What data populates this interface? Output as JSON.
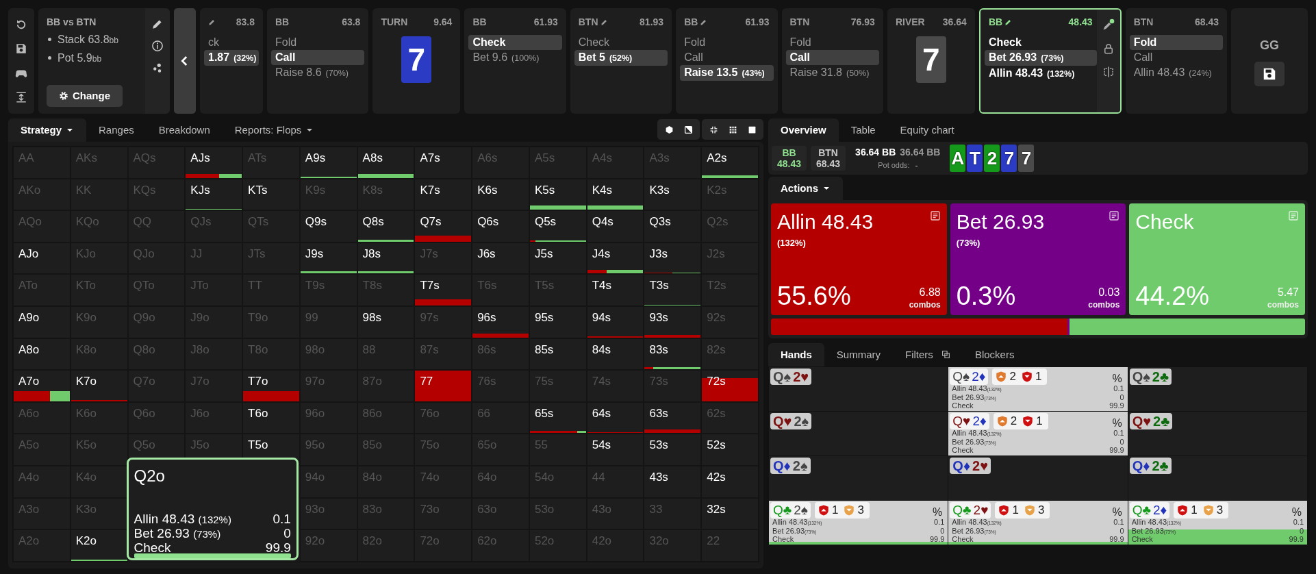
{
  "spot": {
    "title": "BB vs BTN",
    "stats": [
      {
        "label": "Stack 63.8",
        "unit": "bb"
      },
      {
        "label": "Pot 5.9",
        "unit": "bb"
      }
    ],
    "button": "Change"
  },
  "line": [
    {
      "kind": "decision",
      "edit": true,
      "active": false,
      "amount": "83.8",
      "options": [
        {
          "label": "ck",
          "selected": false
        },
        {
          "label": "1.87",
          "pct": "(32%)",
          "selected": true
        }
      ]
    },
    {
      "kind": "decision",
      "player": "BB",
      "edit": false,
      "active": false,
      "amount": "63.8",
      "options": [
        {
          "label": "Fold",
          "selected": false
        },
        {
          "label": "Call",
          "selected": true
        },
        {
          "label": "Raise 8.6",
          "pct": "(70%)",
          "selected": false
        }
      ]
    },
    {
      "kind": "street",
      "street": "TURN",
      "amount": "9.64",
      "card": {
        "rank": "7",
        "color": "#2b3bc4"
      }
    },
    {
      "kind": "decision",
      "player": "BB",
      "edit": false,
      "active": false,
      "amount": "61.93",
      "options": [
        {
          "label": "Check",
          "selected": true
        },
        {
          "label": "Bet 9.6",
          "pct": "(100%)",
          "selected": false
        }
      ]
    },
    {
      "kind": "decision",
      "player": "BTN",
      "edit": true,
      "active": false,
      "amount": "81.93",
      "options": [
        {
          "label": "Check",
          "selected": false
        },
        {
          "label": "Bet 5",
          "pct": "(52%)",
          "selected": true
        }
      ]
    },
    {
      "kind": "decision",
      "player": "BB",
      "edit": true,
      "active": false,
      "amount": "61.93",
      "options": [
        {
          "label": "Fold",
          "selected": false
        },
        {
          "label": "Call",
          "selected": false
        },
        {
          "label": "Raise 13.5",
          "pct": "(43%)",
          "selected": true
        }
      ]
    },
    {
      "kind": "decision",
      "player": "BTN",
      "edit": false,
      "active": false,
      "amount": "76.93",
      "options": [
        {
          "label": "Fold",
          "selected": false
        },
        {
          "label": "Call",
          "selected": true
        },
        {
          "label": "Raise 31.8",
          "pct": "(50%)",
          "selected": false
        }
      ]
    },
    {
      "kind": "street",
      "street": "RIVER",
      "amount": "36.64",
      "card": {
        "rank": "7",
        "color": "#4a4a4a"
      }
    },
    {
      "kind": "decision",
      "player": "BB",
      "edit": true,
      "active": true,
      "amount": "48.43",
      "options": [
        {
          "label": "Check",
          "selected": false
        },
        {
          "label": "Bet 26.93",
          "pct": "(73%)",
          "selected": true
        },
        {
          "label": "Allin 48.43",
          "pct": "(132%)",
          "selected": false
        }
      ]
    },
    {
      "kind": "decision",
      "player": "BTN",
      "edit": false,
      "active": false,
      "amount": "68.43",
      "options": [
        {
          "label": "Fold",
          "selected": true
        },
        {
          "label": "Call",
          "selected": false
        },
        {
          "label": "Allin 48.43",
          "pct": "(24%)",
          "selected": false
        }
      ]
    },
    {
      "kind": "end",
      "label": "GG"
    }
  ],
  "strategy_tabs": [
    {
      "label": "Strategy",
      "dropdown": true,
      "selected": true
    },
    {
      "label": "Ranges",
      "dropdown": false,
      "selected": false
    },
    {
      "label": "Breakdown",
      "dropdown": false,
      "selected": false
    },
    {
      "label": "Reports: Flops",
      "dropdown": true,
      "selected": false
    }
  ],
  "hand_grid": [
    [
      {
        "label": "AA",
        "in_range": false
      },
      {
        "label": "AKs",
        "in_range": false
      },
      {
        "label": "AQs",
        "in_range": false
      },
      {
        "label": "AJs",
        "in_range": true,
        "kind": "low",
        "mix": [
          {
            "kind": "allin",
            "level": 0.6
          },
          {
            "kind": "check",
            "level": 0.4
          }
        ]
      },
      {
        "label": "ATs",
        "in_range": false
      },
      {
        "label": "A9s",
        "in_range": true,
        "kind": "hairline",
        "mix": [
          {
            "kind": "check",
            "level": 1
          }
        ]
      },
      {
        "label": "A8s",
        "in_range": true,
        "kind": "low",
        "mix": [
          {
            "kind": "check",
            "level": 1
          }
        ]
      },
      {
        "label": "A7s",
        "in_range": true
      },
      {
        "label": "A6s",
        "in_range": false
      },
      {
        "label": "A5s",
        "in_range": false
      },
      {
        "label": "A4s",
        "in_range": false
      },
      {
        "label": "A3s",
        "in_range": false
      },
      {
        "label": "A2s",
        "in_range": true,
        "kind": "thin",
        "mix": [
          {
            "kind": "check",
            "level": 1
          }
        ]
      }
    ],
    [
      {
        "label": "AKo",
        "in_range": false
      },
      {
        "label": "KK",
        "in_range": false
      },
      {
        "label": "KQs",
        "in_range": false
      },
      {
        "label": "KJs",
        "in_range": true,
        "kind": "hairline",
        "mix": [
          {
            "kind": "check",
            "level": 1
          }
        ]
      },
      {
        "label": "KTs",
        "in_range": true
      },
      {
        "label": "K9s",
        "in_range": false
      },
      {
        "label": "K8s",
        "in_range": false
      },
      {
        "label": "K7s",
        "in_range": true
      },
      {
        "label": "K6s",
        "in_range": true
      },
      {
        "label": "K5s",
        "in_range": true,
        "kind": "low",
        "mix": [
          {
            "kind": "check",
            "level": 1
          }
        ]
      },
      {
        "label": "K4s",
        "in_range": true,
        "kind": "low",
        "mix": [
          {
            "kind": "check",
            "level": 1
          }
        ]
      },
      {
        "label": "K3s",
        "in_range": true
      },
      {
        "label": "K2s",
        "in_range": false
      }
    ],
    [
      {
        "label": "AQo",
        "in_range": false
      },
      {
        "label": "KQo",
        "in_range": false
      },
      {
        "label": "QQ",
        "in_range": false
      },
      {
        "label": "QJs",
        "in_range": false
      },
      {
        "label": "QTs",
        "in_range": false
      },
      {
        "label": "Q9s",
        "in_range": true
      },
      {
        "label": "Q8s",
        "in_range": true,
        "kind": "thin",
        "mix": [
          {
            "kind": "check",
            "level": 1
          }
        ]
      },
      {
        "label": "Q7s",
        "in_range": true,
        "kind": "mid",
        "mix": [
          {
            "kind": "allin",
            "level": 1
          }
        ]
      },
      {
        "label": "Q6s",
        "in_range": true
      },
      {
        "label": "Q5s",
        "in_range": true,
        "kind": "hairline",
        "mix": [
          {
            "kind": "allin",
            "level": 0.1
          },
          {
            "kind": "check",
            "level": 0.9
          }
        ]
      },
      {
        "label": "Q4s",
        "in_range": true
      },
      {
        "label": "Q3s",
        "in_range": true
      },
      {
        "label": "Q2s",
        "in_range": false
      }
    ],
    [
      {
        "label": "AJo",
        "in_range": true
      },
      {
        "label": "KJo",
        "in_range": false
      },
      {
        "label": "QJo",
        "in_range": false
      },
      {
        "label": "JJ",
        "in_range": false
      },
      {
        "label": "JTs",
        "in_range": false
      },
      {
        "label": "J9s",
        "in_range": true,
        "kind": "thin",
        "mix": [
          {
            "kind": "check",
            "level": 1
          }
        ]
      },
      {
        "label": "J8s",
        "in_range": true,
        "kind": "thin",
        "mix": [
          {
            "kind": "check",
            "level": 1
          }
        ]
      },
      {
        "label": "J7s",
        "in_range": false
      },
      {
        "label": "J6s",
        "in_range": true
      },
      {
        "label": "J5s",
        "in_range": true
      },
      {
        "label": "J4s",
        "in_range": true,
        "kind": "low",
        "mix": [
          {
            "kind": "allin",
            "level": 0.35
          },
          {
            "kind": "check",
            "level": 0.65
          }
        ]
      },
      {
        "label": "J3s",
        "in_range": true,
        "kind": "hairline",
        "mix": [
          {
            "kind": "allin",
            "level": 0.5
          },
          {
            "kind": "check",
            "level": 0.5
          }
        ]
      },
      {
        "label": "J2s",
        "in_range": false
      }
    ],
    [
      {
        "label": "ATo",
        "in_range": false
      },
      {
        "label": "KTo",
        "in_range": false
      },
      {
        "label": "QTo",
        "in_range": false
      },
      {
        "label": "JTo",
        "in_range": false
      },
      {
        "label": "TT",
        "in_range": false
      },
      {
        "label": "T9s",
        "in_range": false
      },
      {
        "label": "T8s",
        "in_range": false
      },
      {
        "label": "T7s",
        "in_range": true,
        "kind": "mid",
        "mix": [
          {
            "kind": "allin",
            "level": 1
          }
        ]
      },
      {
        "label": "T6s",
        "in_range": false
      },
      {
        "label": "T5s",
        "in_range": false
      },
      {
        "label": "T4s",
        "in_range": true
      },
      {
        "label": "T3s",
        "in_range": true,
        "kind": "hairline",
        "mix": [
          {
            "kind": "check",
            "level": 1
          }
        ]
      },
      {
        "label": "T2s",
        "in_range": false
      }
    ],
    [
      {
        "label": "A9o",
        "in_range": true
      },
      {
        "label": "K9o",
        "in_range": false
      },
      {
        "label": "Q9o",
        "in_range": false
      },
      {
        "label": "J9o",
        "in_range": false
      },
      {
        "label": "T9o",
        "in_range": false
      },
      {
        "label": "99",
        "in_range": false
      },
      {
        "label": "98s",
        "in_range": true
      },
      {
        "label": "97s",
        "in_range": false
      },
      {
        "label": "96s",
        "in_range": true,
        "kind": "low",
        "mix": [
          {
            "kind": "allin",
            "level": 1
          }
        ]
      },
      {
        "label": "95s",
        "in_range": true
      },
      {
        "label": "94s",
        "in_range": true,
        "kind": "hairline",
        "mix": [
          {
            "kind": "allin",
            "level": 1
          }
        ]
      },
      {
        "label": "93s",
        "in_range": true,
        "kind": "thin",
        "mix": [
          {
            "kind": "allin",
            "level": 1
          }
        ]
      },
      {
        "label": "92s",
        "in_range": false
      }
    ],
    [
      {
        "label": "A8o",
        "in_range": true
      },
      {
        "label": "K8o",
        "in_range": false
      },
      {
        "label": "Q8o",
        "in_range": false
      },
      {
        "label": "J8o",
        "in_range": false
      },
      {
        "label": "T8o",
        "in_range": false
      },
      {
        "label": "98o",
        "in_range": false
      },
      {
        "label": "88",
        "in_range": false
      },
      {
        "label": "87s",
        "in_range": false
      },
      {
        "label": "86s",
        "in_range": false
      },
      {
        "label": "85s",
        "in_range": true
      },
      {
        "label": "84s",
        "in_range": true
      },
      {
        "label": "83s",
        "in_range": true,
        "kind": "thin",
        "mix": [
          {
            "kind": "allin",
            "level": 0.15
          },
          {
            "kind": "check",
            "level": 0.85
          }
        ]
      },
      {
        "label": "82s",
        "in_range": false
      }
    ],
    [
      {
        "label": "A7o",
        "in_range": true,
        "kind": "half",
        "mix": [
          {
            "kind": "allin",
            "level": 0.65
          },
          {
            "kind": "check",
            "level": 0.35
          }
        ]
      },
      {
        "label": "K7o",
        "in_range": true,
        "kind": "hairline",
        "mix": [
          {
            "kind": "allin",
            "level": 1
          }
        ]
      },
      {
        "label": "Q7o",
        "in_range": false
      },
      {
        "label": "J7o",
        "in_range": false
      },
      {
        "label": "T7o",
        "in_range": true,
        "kind": "half",
        "mix": [
          {
            "kind": "allin",
            "level": 1
          }
        ]
      },
      {
        "label": "97o",
        "in_range": false
      },
      {
        "label": "87o",
        "in_range": false
      },
      {
        "label": "77",
        "in_range": true,
        "kind": "full",
        "mix": [
          {
            "kind": "allin",
            "level": 1
          }
        ]
      },
      {
        "label": "76s",
        "in_range": false
      },
      {
        "label": "75s",
        "in_range": false
      },
      {
        "label": "74s",
        "in_range": false
      },
      {
        "label": "73s",
        "in_range": false
      },
      {
        "label": "72s",
        "in_range": true,
        "kind": "high",
        "mix": [
          {
            "kind": "allin",
            "level": 1
          }
        ]
      }
    ],
    [
      {
        "label": "A6o",
        "in_range": false
      },
      {
        "label": "K6o",
        "in_range": false
      },
      {
        "label": "Q6o",
        "in_range": false
      },
      {
        "label": "J6o",
        "in_range": false
      },
      {
        "label": "T6o",
        "in_range": true
      },
      {
        "label": "96o",
        "in_range": false
      },
      {
        "label": "86o",
        "in_range": false
      },
      {
        "label": "76o",
        "in_range": false
      },
      {
        "label": "66",
        "in_range": false
      },
      {
        "label": "65s",
        "in_range": true,
        "kind": "thin",
        "mix": [
          {
            "kind": "allin",
            "level": 0.85
          },
          {
            "kind": "check",
            "level": 0.15
          }
        ]
      },
      {
        "label": "64s",
        "in_range": true,
        "kind": "hairline",
        "mix": [
          {
            "kind": "allin",
            "level": 1
          }
        ]
      },
      {
        "label": "63s",
        "in_range": true,
        "kind": "low",
        "mix": [
          {
            "kind": "allin",
            "level": 1
          }
        ]
      },
      {
        "label": "62s",
        "in_range": false
      }
    ],
    [
      {
        "label": "A5o",
        "in_range": false
      },
      {
        "label": "K5o",
        "in_range": false
      },
      {
        "label": "Q5o",
        "in_range": false
      },
      {
        "label": "J5o",
        "in_range": false
      },
      {
        "label": "T5o",
        "in_range": true
      },
      {
        "label": "95o",
        "in_range": false
      },
      {
        "label": "85o",
        "in_range": false
      },
      {
        "label": "75o",
        "in_range": false
      },
      {
        "label": "65o",
        "in_range": false
      },
      {
        "label": "55",
        "in_range": false
      },
      {
        "label": "54s",
        "in_range": true
      },
      {
        "label": "53s",
        "in_range": true
      },
      {
        "label": "52s",
        "in_range": true
      }
    ],
    [
      {
        "label": "A4o",
        "in_range": false
      },
      {
        "label": "K4o",
        "in_range": false
      },
      {
        "label": "94o",
        "in_range": false
      },
      {
        "label": "84o",
        "in_range": false
      },
      {
        "label": "74o",
        "in_range": false
      },
      {
        "label": "64o",
        "in_range": false
      },
      {
        "label": "54o",
        "in_range": false
      },
      {
        "label": "44",
        "in_range": false
      },
      {
        "label": "43s",
        "in_range": true
      },
      {
        "label": "42s",
        "in_range": true
      }
    ],
    [
      {
        "label": "A3o",
        "in_range": false
      },
      {
        "label": "K3o",
        "in_range": false
      },
      {
        "label": "93o",
        "in_range": false
      },
      {
        "label": "83o",
        "in_range": false
      },
      {
        "label": "73o",
        "in_range": false
      },
      {
        "label": "63o",
        "in_range": false
      },
      {
        "label": "53o",
        "in_range": false
      },
      {
        "label": "43o",
        "in_range": false
      },
      {
        "label": "33",
        "in_range": false
      },
      {
        "label": "32s",
        "in_range": true
      }
    ],
    [
      {
        "label": "A2o",
        "in_range": false
      },
      {
        "label": "K2o",
        "in_range": true,
        "kind": "hairline",
        "mix": [
          {
            "kind": "check",
            "level": 1
          }
        ]
      },
      {
        "label": "92o",
        "in_range": false
      },
      {
        "label": "82o",
        "in_range": false
      },
      {
        "label": "72o",
        "in_range": false
      },
      {
        "label": "62o",
        "in_range": false
      },
      {
        "label": "52o",
        "in_range": false
      },
      {
        "label": "42o",
        "in_range": false
      },
      {
        "label": "32o",
        "in_range": false
      },
      {
        "label": "22",
        "in_range": false
      }
    ]
  ],
  "tooltip": {
    "hand": "Q2o",
    "level": 0.999,
    "lines": [
      {
        "label": "Allin 48.43",
        "pct": "(132%)",
        "value": "0.1"
      },
      {
        "label": "Bet 26.93",
        "pct": "(73%)",
        "value": "0"
      },
      {
        "label": "Check",
        "value": "99.9"
      }
    ]
  },
  "overview_tabs": [
    {
      "label": "Overview",
      "selected": true
    },
    {
      "label": "Table",
      "selected": false
    },
    {
      "label": "Equity chart",
      "selected": false
    }
  ],
  "summary": {
    "players": [
      {
        "name": "BB",
        "stack": "48.43",
        "active": true
      },
      {
        "name": "BTN",
        "stack": "68.43",
        "active": false
      }
    ],
    "pot": "36.64 BB",
    "pot_alt": "36.64 BB",
    "pot_odds_label": "Pot odds:",
    "pot_odds": "-",
    "board": [
      {
        "rank": "A",
        "color": "#14991a"
      },
      {
        "rank": "T",
        "color": "#2b3bc4"
      },
      {
        "rank": "2",
        "color": "#14991a"
      },
      {
        "rank": "7",
        "color": "#2b3bc4"
      },
      {
        "rank": "7",
        "color": "#4a4a4a"
      }
    ]
  },
  "actions_tab": "Actions",
  "actions": [
    {
      "kind": "allin",
      "label": "Allin 48.43",
      "pct": "(132%)",
      "share": "55.6%",
      "combos": "6.88",
      "unit": "combos",
      "color": "#b50000",
      "level": 0.556
    },
    {
      "kind": "bet",
      "label": "Bet 26.93",
      "pct": "(73%)",
      "share": "0.3%",
      "combos": "0.03",
      "unit": "combos",
      "color": "#740087",
      "level": 0.003
    },
    {
      "kind": "check",
      "label": "Check",
      "share": "44.2%",
      "combos": "5.47",
      "unit": "combos",
      "color": "#6fcb6b",
      "level": 0.442
    }
  ],
  "hands_tabs": [
    {
      "label": "Hands",
      "selected": true
    },
    {
      "label": "Summary",
      "selected": false
    },
    {
      "label": "Filters",
      "selected": false
    },
    {
      "label": "Blockers",
      "selected": false
    }
  ],
  "combos": [
    {
      "kind": "plain",
      "in_range": false,
      "cards": [
        {
          "rank": "Q",
          "suit": "♠",
          "color": "#454545"
        },
        {
          "rank": "2",
          "suit": "♥",
          "color": "#7d1010"
        }
      ]
    },
    {
      "kind": "plain",
      "in_range": true,
      "cards": [
        {
          "rank": "Q",
          "suit": "♠",
          "color": "#454545"
        },
        {
          "rank": "2",
          "suit": "♦",
          "color": "#2233bb"
        }
      ],
      "blockers": [
        {
          "kind": "up",
          "color": "#e07a2e",
          "count": "2"
        },
        {
          "kind": "down",
          "color": "#d01010",
          "count": "1"
        }
      ],
      "unit": "%",
      "lines": [
        {
          "label": "Allin 48.43",
          "pct": "(132%)",
          "value": "0.1"
        },
        {
          "label": "Bet 26.93",
          "pct": "(73%)",
          "value": "0"
        },
        {
          "label": "Check",
          "value": "99.9"
        }
      ]
    },
    {
      "kind": "plain",
      "in_range": false,
      "cards": [
        {
          "rank": "Q",
          "suit": "♠",
          "color": "#454545"
        },
        {
          "rank": "2",
          "suit": "♣",
          "color": "#0e6a0e"
        }
      ]
    },
    {
      "kind": "plain",
      "in_range": false,
      "cards": [
        {
          "rank": "Q",
          "suit": "♥",
          "color": "#7d1010"
        },
        {
          "rank": "2",
          "suit": "♠",
          "color": "#454545"
        }
      ]
    },
    {
      "kind": "plain",
      "in_range": true,
      "cards": [
        {
          "rank": "Q",
          "suit": "♥",
          "color": "#7d1010"
        },
        {
          "rank": "2",
          "suit": "♦",
          "color": "#2233bb"
        }
      ],
      "blockers": [
        {
          "kind": "up",
          "color": "#e07a2e",
          "count": "2"
        },
        {
          "kind": "down",
          "color": "#d01010",
          "count": "1"
        }
      ],
      "unit": "%",
      "lines": [
        {
          "label": "Allin 48.43",
          "pct": "(132%)",
          "value": "0.1"
        },
        {
          "label": "Bet 26.93",
          "pct": "(73%)",
          "value": "0"
        },
        {
          "label": "Check",
          "value": "99.9"
        }
      ]
    },
    {
      "kind": "plain",
      "in_range": false,
      "cards": [
        {
          "rank": "Q",
          "suit": "♥",
          "color": "#7d1010"
        },
        {
          "rank": "2",
          "suit": "♣",
          "color": "#0e6a0e"
        }
      ]
    },
    {
      "kind": "plain",
      "in_range": false,
      "cards": [
        {
          "rank": "Q",
          "suit": "♦",
          "color": "#2233bb"
        },
        {
          "rank": "2",
          "suit": "♠",
          "color": "#454545"
        }
      ]
    },
    {
      "kind": "plain",
      "in_range": false,
      "cards": [
        {
          "rank": "Q",
          "suit": "♦",
          "color": "#2233bb"
        },
        {
          "rank": "2",
          "suit": "♥",
          "color": "#7d1010"
        }
      ]
    },
    {
      "kind": "plain",
      "in_range": false,
      "cards": [
        {
          "rank": "Q",
          "suit": "♦",
          "color": "#2233bb"
        },
        {
          "rank": "2",
          "suit": "♣",
          "color": "#0e6a0e"
        }
      ]
    },
    {
      "kind": "thin",
      "in_range": true,
      "cards": [
        {
          "rank": "Q",
          "suit": "♣",
          "color": "#14991a"
        },
        {
          "rank": "2",
          "suit": "♠",
          "color": "#454545"
        }
      ],
      "blockers": [
        {
          "kind": "up",
          "color": "#d01010",
          "count": "1"
        },
        {
          "kind": "down",
          "color": "#e8a24a",
          "count": "3"
        }
      ],
      "unit": "%",
      "lines": [
        {
          "label": "Allin 48.43",
          "pct": "(132%)",
          "value": "0.1"
        },
        {
          "label": "Bet 26.93",
          "pct": "(73%)",
          "value": "0"
        },
        {
          "label": "Check",
          "value": "99.9"
        }
      ]
    },
    {
      "kind": "thin",
      "in_range": true,
      "cards": [
        {
          "rank": "Q",
          "suit": "♣",
          "color": "#14991a"
        },
        {
          "rank": "2",
          "suit": "♥",
          "color": "#7d1010"
        }
      ],
      "blockers": [
        {
          "kind": "up",
          "color": "#d01010",
          "count": "1"
        },
        {
          "kind": "down",
          "color": "#e8a24a",
          "count": "3"
        }
      ],
      "unit": "%",
      "lines": [
        {
          "label": "Allin 48.43",
          "pct": "(132%)",
          "value": "0.1"
        },
        {
          "label": "Bet 26.93",
          "pct": "(73%)",
          "value": "0"
        },
        {
          "label": "Check",
          "value": "99.9"
        }
      ]
    },
    {
      "kind": "tall",
      "in_range": true,
      "cards": [
        {
          "rank": "Q",
          "suit": "♣",
          "color": "#14991a"
        },
        {
          "rank": "2",
          "suit": "♦",
          "color": "#2233bb"
        }
      ],
      "blockers": [
        {
          "kind": "up",
          "color": "#d01010",
          "count": "1"
        },
        {
          "kind": "down",
          "color": "#e8a24a",
          "count": "3"
        }
      ],
      "unit": "%",
      "lines": [
        {
          "label": "Allin 48.43",
          "pct": "(132%)",
          "value": "0.1"
        },
        {
          "label": "Bet 26.93",
          "pct": "(73%)",
          "value": "0"
        },
        {
          "label": "Check",
          "value": "99.9"
        }
      ]
    }
  ]
}
